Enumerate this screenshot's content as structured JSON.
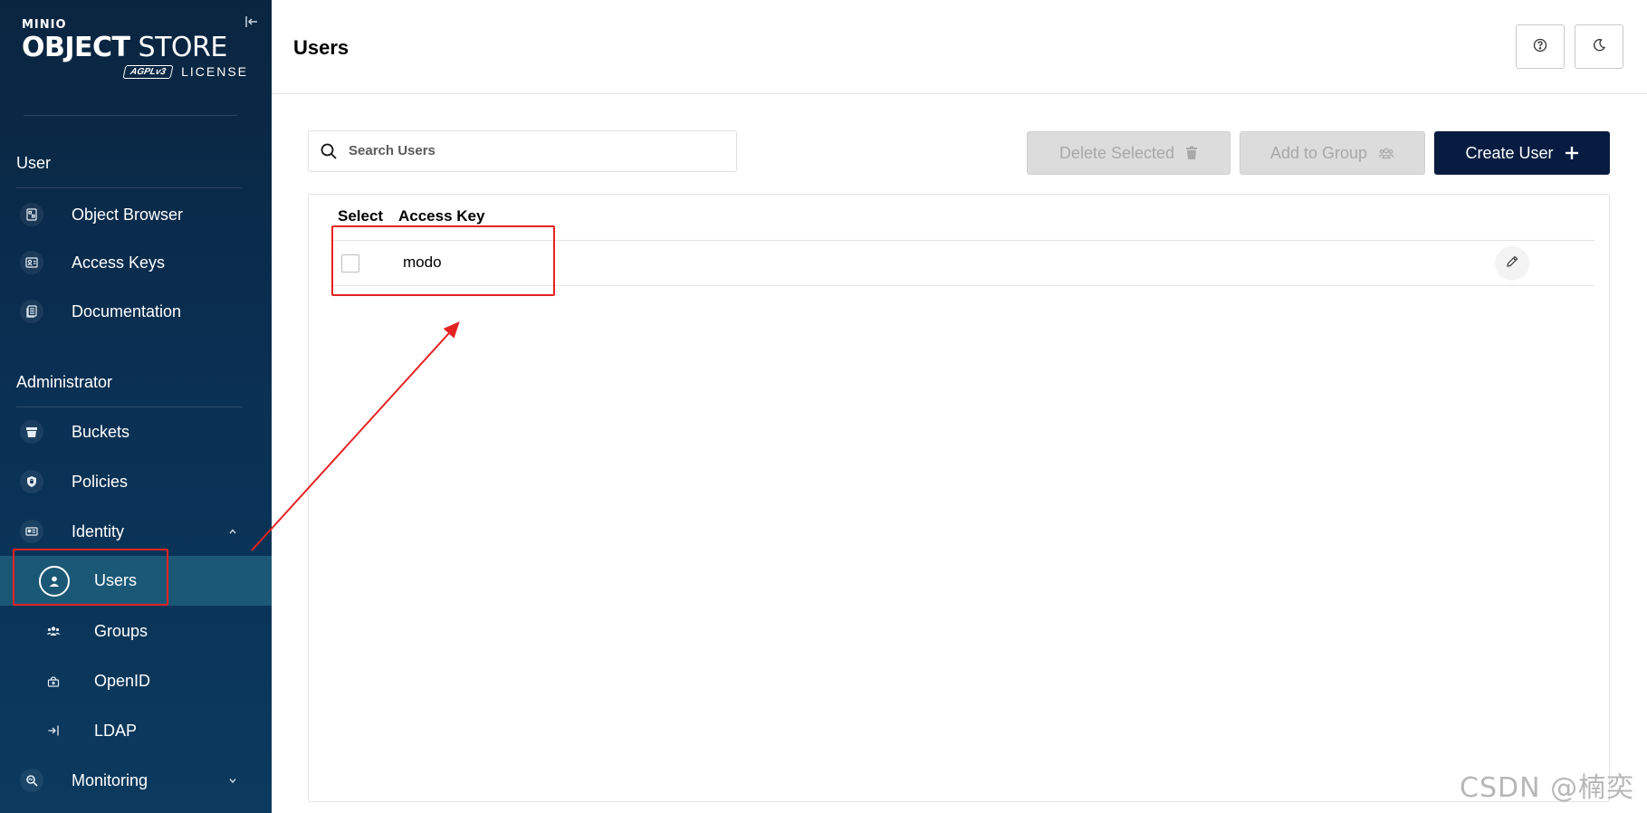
{
  "sidebar": {
    "logo": {
      "brand": "MINIO",
      "title_bold": "OBJECT",
      "title_rest": " STORE",
      "badge": "AGPLv3",
      "license": "LICENSE"
    },
    "sections": [
      {
        "title": "User",
        "items": [
          {
            "label": "Object Browser",
            "icon": "object-browser-icon"
          },
          {
            "label": "Access Keys",
            "icon": "access-keys-icon"
          },
          {
            "label": "Documentation",
            "icon": "documentation-icon"
          }
        ]
      },
      {
        "title": "Administrator",
        "items": [
          {
            "label": "Buckets",
            "icon": "buckets-icon"
          },
          {
            "label": "Policies",
            "icon": "policies-icon"
          },
          {
            "label": "Identity",
            "icon": "identity-icon",
            "expanded": true,
            "children": [
              {
                "label": "Users",
                "icon": "user-icon",
                "active": true
              },
              {
                "label": "Groups",
                "icon": "groups-icon"
              },
              {
                "label": "OpenID",
                "icon": "openid-icon"
              },
              {
                "label": "LDAP",
                "icon": "ldap-icon"
              }
            ]
          },
          {
            "label": "Monitoring",
            "icon": "monitoring-icon",
            "expanded": false
          }
        ]
      }
    ]
  },
  "header": {
    "title": "Users"
  },
  "toolbar": {
    "search_placeholder": "Search Users",
    "delete_label": "Delete Selected",
    "add_group_label": "Add to Group",
    "create_label": "Create User"
  },
  "table": {
    "columns": [
      "Select",
      "Access Key"
    ],
    "rows": [
      {
        "access_key": "modo",
        "selected": false
      }
    ]
  },
  "watermark": "CSDN @楠奕",
  "colors": {
    "sidebar_bg": "#0a2540",
    "active_item": "#1b5876",
    "primary_button": "#081c42",
    "annotation": "#e52222"
  }
}
